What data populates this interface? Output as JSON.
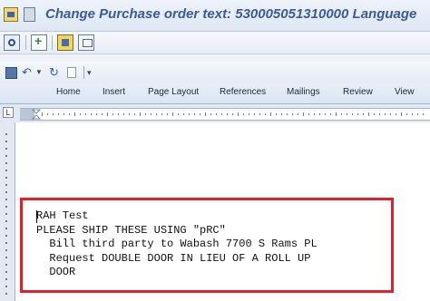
{
  "window": {
    "title": "Change Purchase order text: 530005051310000 Language"
  },
  "quick_access": {
    "icons": [
      "save-icon",
      "undo-icon",
      "redo-icon",
      "new-document-icon",
      "customize-icon"
    ]
  },
  "ribbon": {
    "tabs": [
      "Home",
      "Insert",
      "Page Layout",
      "References",
      "Mailings",
      "Review",
      "View"
    ]
  },
  "ruler": {
    "tab_selector": "L"
  },
  "document": {
    "lines": [
      "RAH Test",
      "PLEASE SHIP THESE USING \"pRC\"",
      "  Bill third party to Wabash 7700 S Rams PL",
      "  Request DOUBLE DOOR IN LIEU OF A ROLL UP",
      "  DOOR"
    ],
    "highlight_color": "#e1202a"
  }
}
